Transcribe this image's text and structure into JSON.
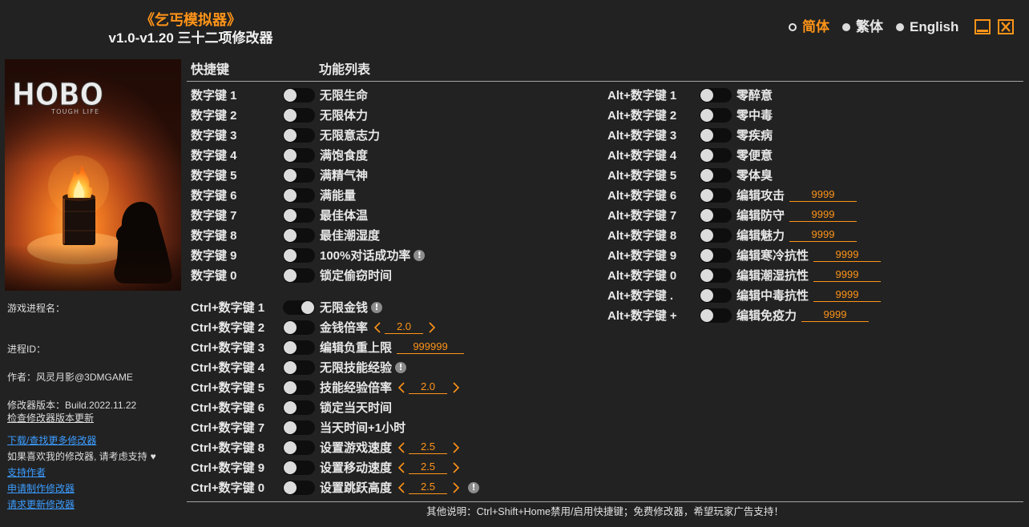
{
  "window": {
    "title": "《乞丐模拟器》",
    "subtitle": "v1.0-v1.20 三十二项修改器",
    "languages": [
      {
        "label": "简体",
        "selected": true
      },
      {
        "label": "繁体",
        "selected": false
      },
      {
        "label": "English",
        "selected": false
      }
    ],
    "minimize_icon": "minimize-icon",
    "close_icon": "close-icon"
  },
  "game_art": {
    "logo_text": "HOBO",
    "logo_subtext": "TOUGH LIFE"
  },
  "info": {
    "process_name_label": "游戏进程名：",
    "process_id_label": "进程ID：",
    "author": "作者：风灵月影@3DMGAME",
    "version": "修改器版本：Build.2022.11.22",
    "check_update": "检查修改器版本更新",
    "download_more": "下载/查找更多修改器",
    "support_note": "如果喜欢我的修改器, 请考虑支持",
    "support_note_icon": "heart-icon",
    "support_author": "支持作者",
    "request_trainer": "申请制作修改器",
    "request_update": "请求更新修改器"
  },
  "headers": {
    "hotkey": "快捷键",
    "features": "功能列表"
  },
  "cheats": {
    "numpad": [
      {
        "key": "数字键 1",
        "label": "无限生命",
        "on": false
      },
      {
        "key": "数字键 2",
        "label": "无限体力",
        "on": false
      },
      {
        "key": "数字键 3",
        "label": "无限意志力",
        "on": false
      },
      {
        "key": "数字键 4",
        "label": "满饱食度",
        "on": false
      },
      {
        "key": "数字键 5",
        "label": "满精气神",
        "on": false
      },
      {
        "key": "数字键 6",
        "label": "满能量",
        "on": false
      },
      {
        "key": "数字键 7",
        "label": "最佳体温",
        "on": false
      },
      {
        "key": "数字键 8",
        "label": "最佳潮湿度",
        "on": false
      },
      {
        "key": "数字键 9",
        "label": "100%对话成功率",
        "on": false,
        "icon": "info-icon"
      },
      {
        "key": "数字键 0",
        "label": "锁定偷窃时间",
        "on": false
      }
    ],
    "ctrl": [
      {
        "key": "Ctrl+数字键 1",
        "label": "无限金钱",
        "on": true,
        "icon": "info-icon"
      },
      {
        "key": "Ctrl+数字键 2",
        "label": "金钱倍率",
        "on": false,
        "spinner": "2.0"
      },
      {
        "key": "Ctrl+数字键 3",
        "label": "编辑负重上限",
        "on": false,
        "input": "999999"
      },
      {
        "key": "Ctrl+数字键 4",
        "label": "无限技能经验",
        "on": false,
        "icon": "info-icon"
      },
      {
        "key": "Ctrl+数字键 5",
        "label": "技能经验倍率",
        "on": false,
        "spinner": "2.0"
      },
      {
        "key": "Ctrl+数字键 6",
        "label": "锁定当天时间",
        "on": false
      },
      {
        "key": "Ctrl+数字键 7",
        "label": "当天时间+1小时",
        "on": false
      },
      {
        "key": "Ctrl+数字键 8",
        "label": "设置游戏速度",
        "on": false,
        "spinner": "2.5"
      },
      {
        "key": "Ctrl+数字键 9",
        "label": "设置移动速度",
        "on": false,
        "spinner": "2.5"
      },
      {
        "key": "Ctrl+数字键 0",
        "label": "设置跳跃高度",
        "on": false,
        "spinner": "2.5",
        "icon": "info-icon"
      }
    ],
    "alt": [
      {
        "key": "Alt+数字键 1",
        "label": "零醉意",
        "on": false
      },
      {
        "key": "Alt+数字键 2",
        "label": "零中毒",
        "on": false
      },
      {
        "key": "Alt+数字键 3",
        "label": "零疾病",
        "on": false
      },
      {
        "key": "Alt+数字键 4",
        "label": "零便意",
        "on": false
      },
      {
        "key": "Alt+数字键 5",
        "label": "零体臭",
        "on": false
      },
      {
        "key": "Alt+数字键 6",
        "label": "编辑攻击",
        "on": false,
        "input": "9999"
      },
      {
        "key": "Alt+数字键 7",
        "label": "编辑防守",
        "on": false,
        "input": "9999"
      },
      {
        "key": "Alt+数字键 8",
        "label": "编辑魅力",
        "on": false,
        "input": "9999"
      },
      {
        "key": "Alt+数字键 9",
        "label": "编辑寒冷抗性",
        "on": false,
        "input": "9999"
      },
      {
        "key": "Alt+数字键 0",
        "label": "编辑潮湿抗性",
        "on": false,
        "input": "9999"
      },
      {
        "key": "Alt+数字键 .",
        "label": "编辑中毒抗性",
        "on": false,
        "input": "9999"
      },
      {
        "key": "Alt+数字键 +",
        "label": "编辑免疫力",
        "on": false,
        "input": "9999"
      }
    ]
  },
  "footer": "其他说明：Ctrl+Shift+Home禁用/启用快捷键；免费修改器，希望玩家广告支持！",
  "colors": {
    "accent": "#ff9418",
    "link": "#3b9cff",
    "background": "#222222",
    "text": "#e8e8e8"
  }
}
